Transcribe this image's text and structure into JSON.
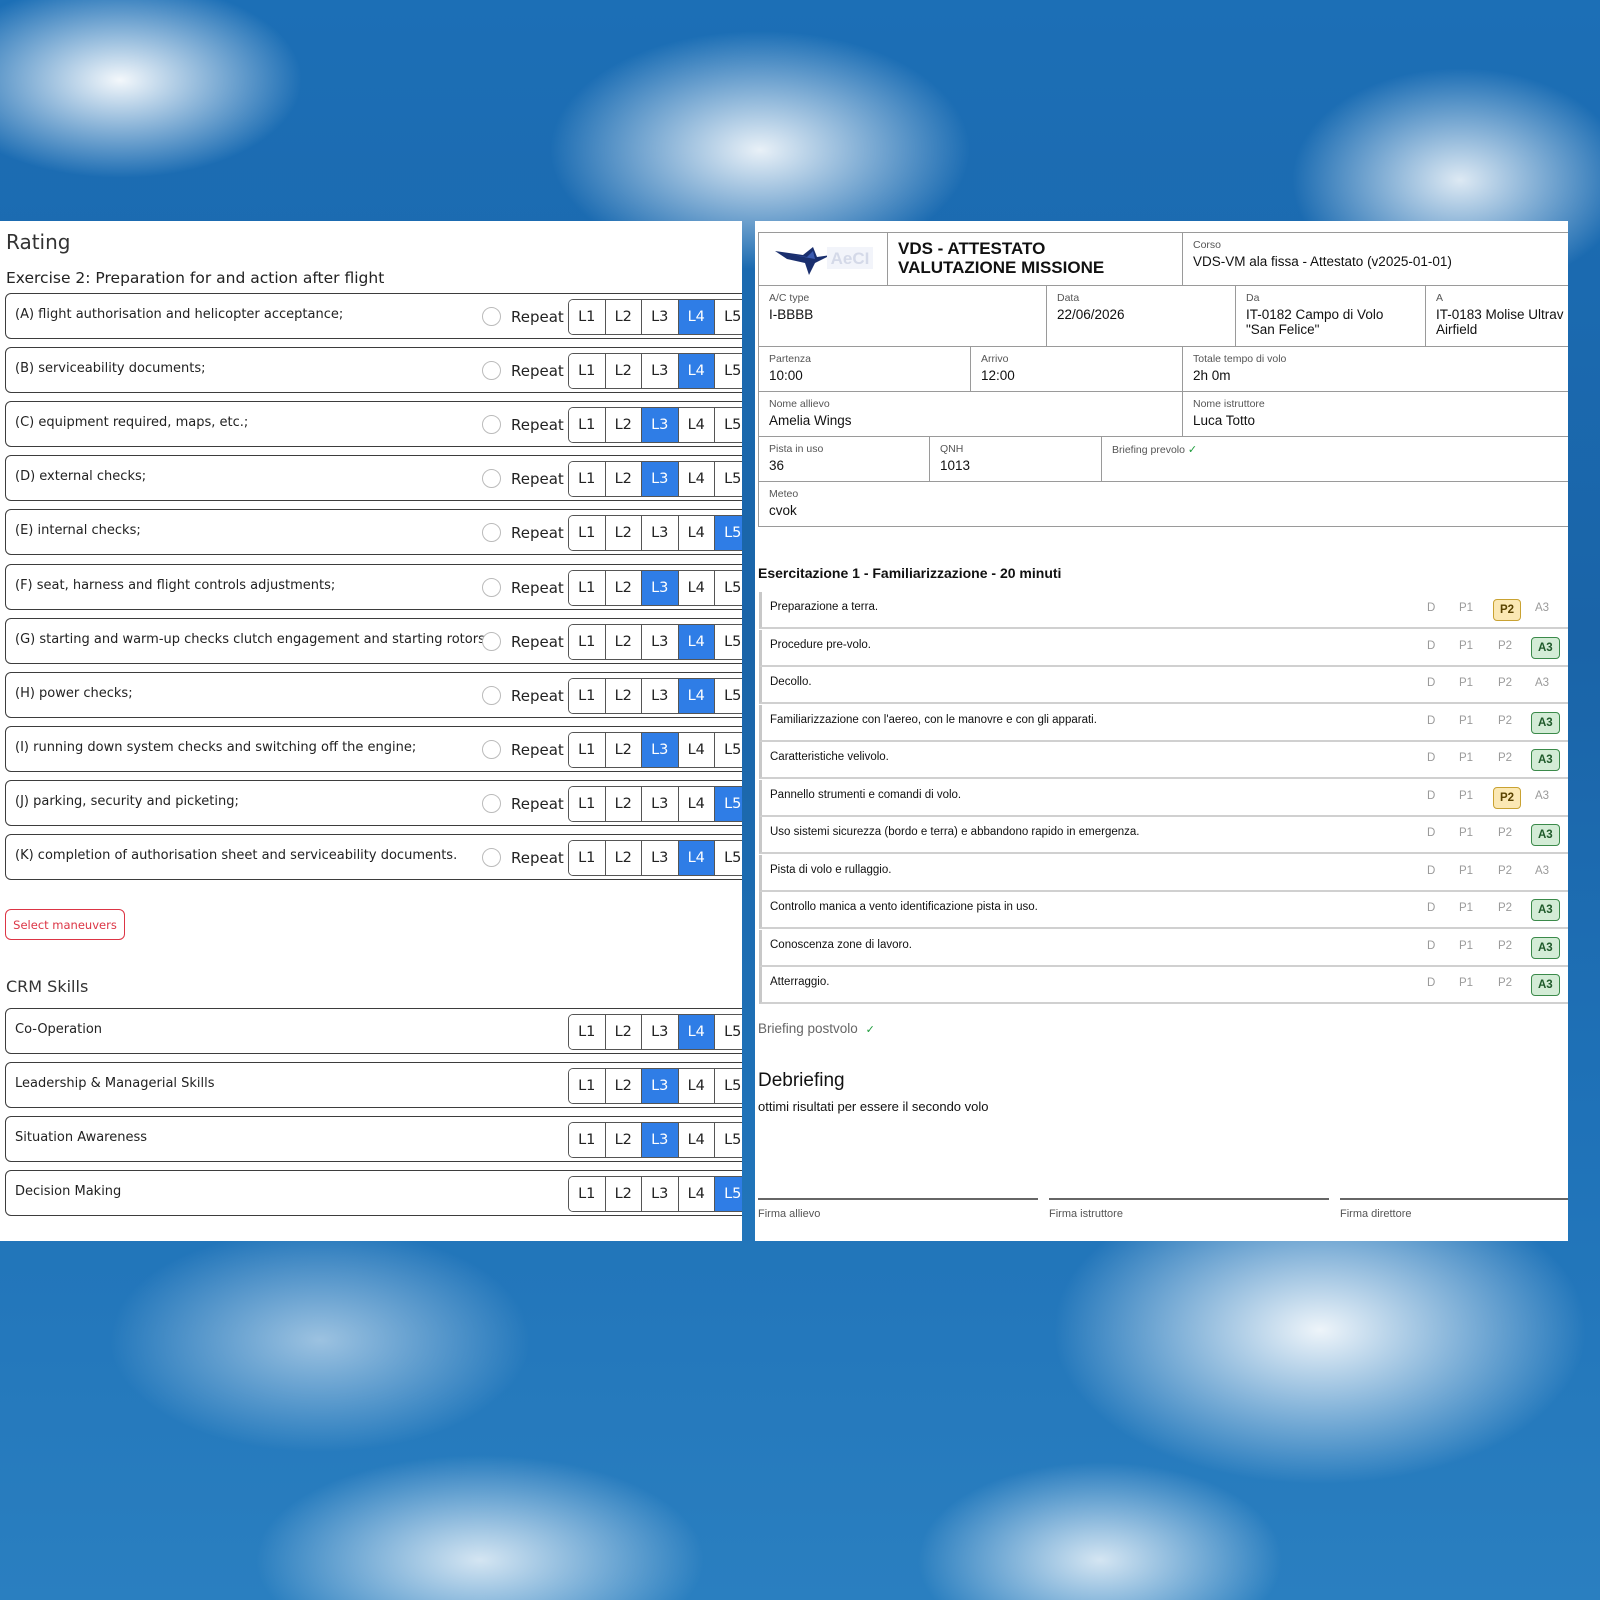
{
  "left": {
    "rating_title": "Rating",
    "exercise_title": "Exercise 2: Preparation for and action after flight",
    "repeat_label": "Repeat",
    "level_labels": [
      "L1",
      "L2",
      "L3",
      "L4",
      "L5"
    ],
    "items": [
      {
        "label": "(A) flight authorisation and helicopter acceptance;",
        "selected": "L4"
      },
      {
        "label": "(B) serviceability documents;",
        "selected": "L4"
      },
      {
        "label": "(C) equipment required, maps, etc.;",
        "selected": "L3"
      },
      {
        "label": "(D) external checks;",
        "selected": "L3"
      },
      {
        "label": "(E) internal checks;",
        "selected": "L5"
      },
      {
        "label": "(F) seat, harness and flight controls adjustments;",
        "selected": "L3"
      },
      {
        "label": "(G) starting and warm-up checks clutch engagement and starting rotors;",
        "selected": "L4"
      },
      {
        "label": "(H) power checks;",
        "selected": "L4"
      },
      {
        "label": "(I) running down system checks and switching off the engine;",
        "selected": "L3"
      },
      {
        "label": "(J) parking, security and picketing;",
        "selected": "L5"
      },
      {
        "label": "(K) completion of authorisation sheet and serviceability documents.",
        "selected": "L4"
      }
    ],
    "select_maneuvers_label": "Select maneuvers",
    "crm_title": "CRM Skills",
    "crm_items": [
      {
        "label": "Co-Operation",
        "selected": "L4"
      },
      {
        "label": "Leadership & Managerial Skills",
        "selected": "L3"
      },
      {
        "label": "Situation Awareness",
        "selected": "L3"
      },
      {
        "label": "Decision Making",
        "selected": "L5"
      }
    ],
    "accent_color": "#2f7de6"
  },
  "right": {
    "logo_text": "AeCI",
    "doc_title_line1": "VDS - ATTESTATO",
    "doc_title_line2": "VALUTAZIONE MISSIONE",
    "corso_caption": "Corso",
    "corso_value": "VDS-VM ala fissa - Attestato (v2025-01-01)",
    "ac_type_caption": "A/C type",
    "ac_type_value": "I-BBBB",
    "data_caption": "Data",
    "data_value": "22/06/2026",
    "da_caption": "Da",
    "da_value_line1": "IT-0182 Campo di Volo",
    "da_value_line2": "\"San Felice\"",
    "a_caption": "A",
    "a_value_line1": "IT-0183 Molise Ultrav",
    "a_value_line2": "Airfield",
    "partenza_caption": "Partenza",
    "partenza_value": "10:00",
    "arrivo_caption": "Arrivo",
    "arrivo_value": "12:00",
    "totale_caption": "Totale tempo di volo",
    "totale_value": "2h 0m",
    "allievo_caption": "Nome allievo",
    "allievo_value": "Amelia Wings",
    "istruttore_caption": "Nome istruttore",
    "istruttore_value": "Luca Totto",
    "pista_caption": "Pista in uso",
    "pista_value": "36",
    "qnh_caption": "QNH",
    "qnh_value": "1013",
    "briefing_pre_caption": "Briefing prevolo",
    "check_mark": "✓",
    "meteo_caption": "Meteo",
    "meteo_value": "cvok",
    "exercise_heading": "Esercitazione 1 - Familiarizzazione - 20 minuti",
    "grade_labels": [
      "D",
      "P1",
      "P2",
      "A3"
    ],
    "maneuvers": [
      {
        "label": "Preparazione a terra.",
        "grade": "P2"
      },
      {
        "label": "Procedure pre-volo.",
        "grade": "A3"
      },
      {
        "label": "Decollo.",
        "grade": ""
      },
      {
        "label": "Familiarizzazione con l'aereo, con le manovre e con gli apparati.",
        "grade": "A3"
      },
      {
        "label": "Caratteristiche velivolo.",
        "grade": "A3"
      },
      {
        "label": "Pannello strumenti e comandi di volo.",
        "grade": "P2"
      },
      {
        "label": "Uso sistemi sicurezza (bordo e terra) e abbandono rapido in emergenza.",
        "grade": "A3"
      },
      {
        "label": "Pista di volo e rullaggio.",
        "grade": ""
      },
      {
        "label": "Controllo manica a vento identificazione pista in uso.",
        "grade": "A3"
      },
      {
        "label": "Conoscenza zone di lavoro.",
        "grade": "A3"
      },
      {
        "label": "Atterraggio.",
        "grade": "A3"
      }
    ],
    "briefing_post_label": "Briefing postvolo",
    "debriefing_title": "Debriefing",
    "debriefing_text": "ottimi risultati per essere il secondo volo",
    "sig_allievo": "Firma allievo",
    "sig_istruttore": "Firma istruttore",
    "sig_direttore": "Firma direttore"
  }
}
